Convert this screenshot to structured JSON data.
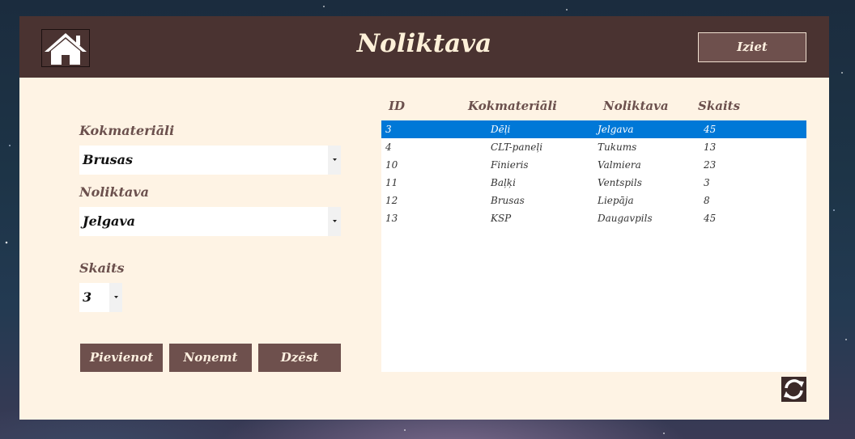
{
  "header": {
    "title": "Noliktava",
    "exit_label": "Iziet",
    "home_icon": "home-icon"
  },
  "form": {
    "material_label": "Kokmateriāli",
    "material_value": "Brusas",
    "warehouse_label": "Noliktava",
    "warehouse_value": "Jelgava",
    "count_label": "Skaits",
    "count_value": "3"
  },
  "actions": {
    "add_label": "Pievienot",
    "remove_label": "Noņemt",
    "delete_label": "Dzēst"
  },
  "table": {
    "columns": [
      "ID",
      "Kokmateriāli",
      "Noliktava",
      "Skaits"
    ],
    "selected_index": 0,
    "rows": [
      [
        "3",
        "Dēļi",
        "Jelgava",
        "45"
      ],
      [
        "4",
        "CLT-paneļi",
        "Tukums",
        "13"
      ],
      [
        "10",
        "Finieris",
        "Valmiera",
        "23"
      ],
      [
        "11",
        "Baļķi",
        "Ventspils",
        "3"
      ],
      [
        "12",
        "Brusas",
        "Liepāja",
        "8"
      ],
      [
        "13",
        "KSP",
        "Daugavpils",
        "45"
      ]
    ]
  },
  "refresh_icon": "refresh-icon",
  "colors": {
    "header_bg": "#4a3331",
    "panel_bg": "#fef3e4",
    "button_bg": "#6e504d",
    "selection": "#0078d7"
  }
}
